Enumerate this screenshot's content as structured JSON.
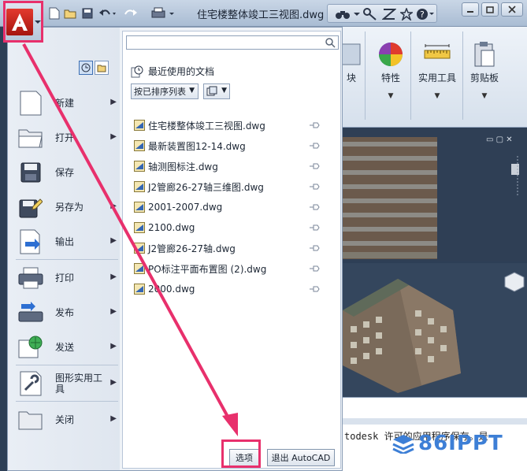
{
  "window": {
    "document_title": "住宅楼整体竣工三视图.dwg"
  },
  "app_menu": {
    "left_items": [
      {
        "label": "新建",
        "icon": "new-document-icon",
        "has_submenu": true
      },
      {
        "label": "打开",
        "icon": "open-folder-icon",
        "has_submenu": true
      },
      {
        "label": "保存",
        "icon": "save-disk-icon",
        "has_submenu": false
      },
      {
        "label": "另存为",
        "icon": "save-as-icon",
        "has_submenu": true
      },
      {
        "label": "输出",
        "icon": "export-icon",
        "has_submenu": true
      },
      {
        "label": "打印",
        "icon": "printer-icon",
        "has_submenu": true
      },
      {
        "label": "发布",
        "icon": "publish-icon",
        "has_submenu": true
      },
      {
        "label": "发送",
        "icon": "send-globe-icon",
        "has_submenu": true
      },
      {
        "label": "图形实用工具",
        "icon": "drawing-utilities-icon",
        "has_submenu": true
      },
      {
        "label": "关闭",
        "icon": "close-folder-icon",
        "has_submenu": true
      }
    ],
    "search": {
      "value": "",
      "placeholder": ""
    },
    "recent": {
      "title": "最近使用的文档",
      "sort_label": "按已排序列表",
      "files": [
        "住宅楼整体竣工三视图.dwg",
        "最新装置图12-14.dwg",
        "轴测图标注.dwg",
        "J2管廊26-27轴三维图.dwg",
        "2001-2007.dwg",
        "2100.dwg",
        "J2管廊26-27轴.dwg",
        "PO标注平面布置图 (2).dwg",
        "2000.dwg"
      ]
    },
    "options_label": "选项",
    "exit_label": "退出 AutoCAD"
  },
  "ribbon": {
    "groups": [
      {
        "label": "块",
        "icon": "block-icon"
      },
      {
        "label": "特性",
        "icon": "properties-color-wheel-icon"
      },
      {
        "label": "实用工具",
        "icon": "measure-ruler-icon"
      },
      {
        "label": "剪贴板",
        "icon": "clipboard-icon"
      }
    ]
  },
  "command_line": {
    "text": "todesk 许可的应用程序保存。是"
  },
  "watermark": {
    "text": "86IPPT"
  },
  "colors": {
    "highlight": "#e8306c",
    "watermark": "#3d7fd6"
  }
}
